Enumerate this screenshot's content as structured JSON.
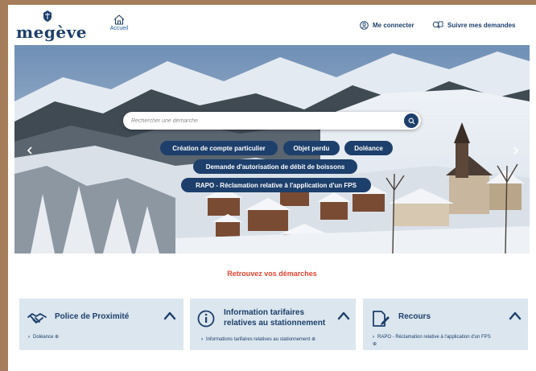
{
  "header": {
    "logo_text": "megève",
    "home_label": "Accueil",
    "login_label": "Me connecter",
    "tracking_label": "Suivre mes demandes"
  },
  "hero": {
    "search_placeholder": "Rechercher une démarche",
    "quick_links": [
      "Création de compte particulier",
      "Objet perdu",
      "Doléance",
      "Demande d'autorisation de débit de boissons",
      "RAPO - Réclamation relative à l'application d'un FPS"
    ]
  },
  "section": {
    "title": "Retrouvez vos démarches"
  },
  "cards": [
    {
      "icon": "handshake-icon",
      "title": "Police de Proximité",
      "link": "Doléance ⊕"
    },
    {
      "icon": "info-icon",
      "title_line1": "Information tarifaires",
      "title_line2": "relatives au stationnement",
      "link": "Informations tarifaires relatives au stationnement ⊕"
    },
    {
      "icon": "document-pen-icon",
      "title": "Recours",
      "link_line1": "RAPO - Réclamation relative à l'application d'un FPS",
      "link_line2": "⊕"
    }
  ],
  "colors": {
    "brand_navy": "#1d3f6b",
    "accent_red": "#e8452f",
    "card_bg": "#dbe6ee",
    "page_border": "#a57d5a"
  }
}
